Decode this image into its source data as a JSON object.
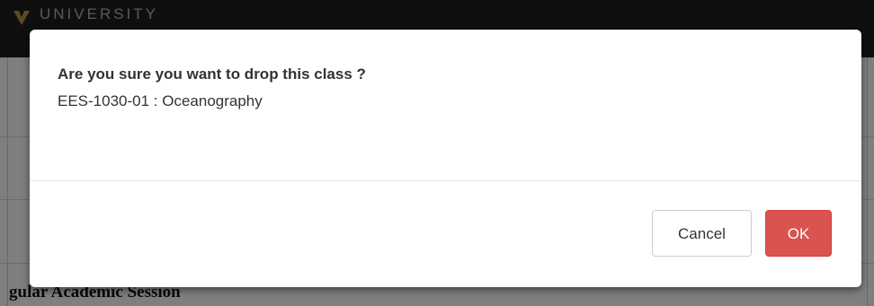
{
  "header": {
    "brand_text": "UNIVERSITY",
    "logo_icon": "university-shield-logo"
  },
  "page": {
    "session_heading": "gular Academic Session"
  },
  "dialog": {
    "title": "Are you sure you want to drop this class ?",
    "message": "EES-1030-01 : Oceanography",
    "cancel_label": "Cancel",
    "ok_label": "OK"
  },
  "colors": {
    "ok_button": "#d9534f",
    "header_bar": "#1f1f1f",
    "logo_gold": "#b8963e"
  }
}
